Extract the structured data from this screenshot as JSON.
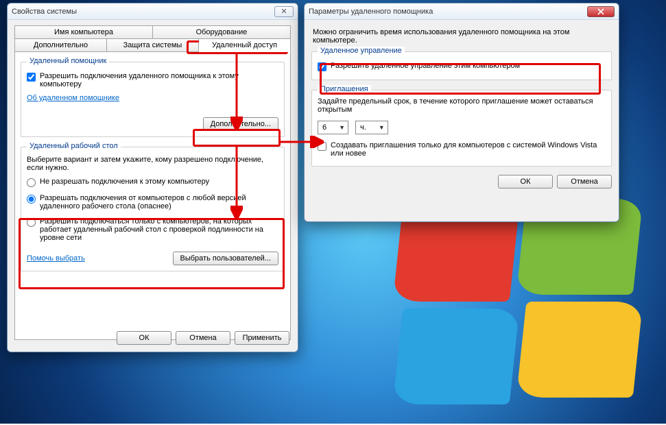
{
  "win1": {
    "title": "Свойства системы",
    "tabs_row1": [
      "Имя компьютера",
      "Оборудование"
    ],
    "tabs_row2": [
      "Дополнительно",
      "Защита системы",
      "Удаленный доступ"
    ],
    "group_assistant": {
      "legend": "Удаленный помощник",
      "cb_label": "Разрешить подключения удаленного помощника к этому компьютеру",
      "link": "Об удаленном помощнике",
      "adv_btn": "Дополнительно..."
    },
    "group_rdp": {
      "legend": "Удаленный рабочий стол",
      "intro": "Выберите вариант и затем укажите, кому разрешено подключение, если нужно.",
      "r1": "Не разрешать подключения к этому компьютеру",
      "r2": "Разрешать подключения от компьютеров с любой версией удаленного рабочего стола (опаснее)",
      "r3": "Разрешить подключаться только с компьютеров, на которых работает удаленный рабочий стол с проверкой подлинности на уровне сети",
      "help_link": "Помочь выбрать",
      "select_users_btn": "Выбрать пользователей..."
    },
    "ok": "ОК",
    "cancel": "Отмена",
    "apply": "Применить"
  },
  "win2": {
    "title": "Параметры удаленного помощника",
    "intro": "Можно ограничить время использования удаленного помощника на этом компьютере.",
    "group_control": {
      "legend": "Удаленное управление",
      "cb_label": "Разрешить удаленное управление этим компьютером"
    },
    "group_invite": {
      "legend": "Приглашения",
      "text": "Задайте предельный срок, в течение которого приглашение может оставаться открытым",
      "num": "6",
      "unit": "ч.",
      "vista_label": "Создавать приглашения только для компьютеров с системой Windows Vista или новее"
    },
    "ok": "ОК",
    "cancel": "Отмена"
  }
}
